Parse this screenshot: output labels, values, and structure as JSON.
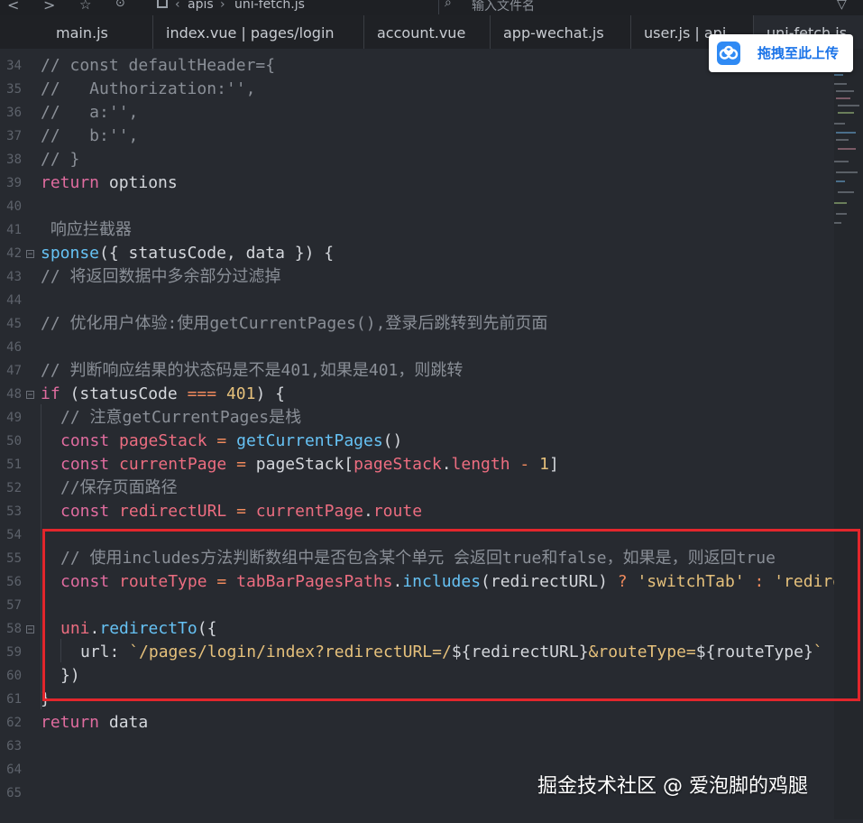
{
  "topbar": {
    "nav_back": "<",
    "nav_forward": ">",
    "breadcrumb": [
      "apis",
      "uni-fetch.js"
    ],
    "search_placeholder": "输入文件名"
  },
  "tabs": [
    {
      "label": "main.js"
    },
    {
      "label": "index.vue | pages/login"
    },
    {
      "label": "account.vue"
    },
    {
      "label": "app-wechat.js"
    },
    {
      "label": "user.js | api"
    },
    {
      "label": "uni-fetch.js"
    }
  ],
  "upload_button": {
    "label": "拖拽至此上传",
    "icon": "cloud-icon"
  },
  "code_lines": [
    {
      "n": "34",
      "fold": "",
      "indent": 0,
      "tokens": [
        [
          "c-cm",
          "// const defaultHeader={"
        ]
      ]
    },
    {
      "n": "35",
      "fold": "",
      "indent": 0,
      "tokens": [
        [
          "c-cm",
          "//   Authorization:'',"
        ]
      ]
    },
    {
      "n": "36",
      "fold": "",
      "indent": 0,
      "tokens": [
        [
          "c-cm",
          "//   a:'',"
        ]
      ]
    },
    {
      "n": "37",
      "fold": "",
      "indent": 0,
      "tokens": [
        [
          "c-cm",
          "//   b:'',"
        ]
      ]
    },
    {
      "n": "38",
      "fold": "",
      "indent": 0,
      "tokens": [
        [
          "c-cm",
          "// }"
        ]
      ]
    },
    {
      "n": "39",
      "fold": "",
      "indent": 0,
      "tokens": [
        [
          "c-kw",
          "return"
        ],
        [
          "c-pl",
          " options"
        ]
      ]
    },
    {
      "n": "40",
      "fold": "",
      "indent": 0,
      "tokens": []
    },
    {
      "n": "41",
      "fold": "",
      "indent": 0,
      "tokens": [
        [
          "c-cm",
          " 响应拦截器"
        ]
      ]
    },
    {
      "n": "42",
      "fold": "⊟",
      "indent": 0,
      "tokens": [
        [
          "c-fn",
          "sponse"
        ],
        [
          "c-pl",
          "({ statusCode, data }) {"
        ]
      ]
    },
    {
      "n": "43",
      "fold": "",
      "indent": 0,
      "tokens": [
        [
          "c-cm",
          "// 将返回数据中多余部分过滤掉"
        ]
      ]
    },
    {
      "n": "44",
      "fold": "",
      "indent": 0,
      "tokens": []
    },
    {
      "n": "45",
      "fold": "",
      "indent": 0,
      "tokens": [
        [
          "c-cm",
          "// 优化用户体验:使用getCurrentPages(),登录后跳转到先前页面"
        ]
      ]
    },
    {
      "n": "46",
      "fold": "",
      "indent": 0,
      "tokens": []
    },
    {
      "n": "47",
      "fold": "",
      "indent": 0,
      "tokens": [
        [
          "c-cm",
          "// 判断响应结果的状态码是不是401,如果是401，则跳转"
        ]
      ]
    },
    {
      "n": "48",
      "fold": "⊟",
      "indent": 0,
      "tokens": [
        [
          "c-kw",
          "if"
        ],
        [
          "c-pl",
          " (statusCode "
        ],
        [
          "c-op",
          "==="
        ],
        [
          "c-pl",
          " "
        ],
        [
          "c-num",
          "401"
        ],
        [
          "c-pl",
          ") {"
        ]
      ]
    },
    {
      "n": "49",
      "fold": "",
      "indent": 1,
      "tokens": [
        [
          "c-cm",
          "// 注意getCurrentPages是栈"
        ]
      ]
    },
    {
      "n": "50",
      "fold": "",
      "indent": 1,
      "tokens": [
        [
          "c-kw",
          "const"
        ],
        [
          "c-pl",
          " "
        ],
        [
          "c-var",
          "pageStack"
        ],
        [
          "c-pl",
          " "
        ],
        [
          "c-op",
          "="
        ],
        [
          "c-pl",
          " "
        ],
        [
          "c-fn",
          "getCurrentPages"
        ],
        [
          "c-pl",
          "()"
        ]
      ]
    },
    {
      "n": "51",
      "fold": "",
      "indent": 1,
      "tokens": [
        [
          "c-kw",
          "const"
        ],
        [
          "c-pl",
          " "
        ],
        [
          "c-var",
          "currentPage"
        ],
        [
          "c-pl",
          " "
        ],
        [
          "c-op",
          "="
        ],
        [
          "c-pl",
          " pageStack["
        ],
        [
          "c-var",
          "pageStack"
        ],
        [
          "c-pl",
          "."
        ],
        [
          "c-var",
          "length"
        ],
        [
          "c-pl",
          " "
        ],
        [
          "c-op",
          "-"
        ],
        [
          "c-pl",
          " "
        ],
        [
          "c-num",
          "1"
        ],
        [
          "c-pl",
          "]"
        ]
      ]
    },
    {
      "n": "52",
      "fold": "",
      "indent": 1,
      "tokens": [
        [
          "c-cm",
          "//保存页面路径"
        ]
      ]
    },
    {
      "n": "53",
      "fold": "",
      "indent": 1,
      "tokens": [
        [
          "c-kw",
          "const"
        ],
        [
          "c-pl",
          " "
        ],
        [
          "c-var",
          "redirectURL"
        ],
        [
          "c-pl",
          " "
        ],
        [
          "c-op",
          "="
        ],
        [
          "c-pl",
          " "
        ],
        [
          "c-var",
          "currentPage"
        ],
        [
          "c-pl",
          "."
        ],
        [
          "c-var",
          "route"
        ]
      ]
    },
    {
      "n": "54",
      "fold": "",
      "indent": 0,
      "tokens": []
    },
    {
      "n": "55",
      "fold": "",
      "indent": 1,
      "tokens": [
        [
          "c-cm",
          "// 使用includes方法判断数组中是否包含某个单元 会返回true和false，如果是，则返回true"
        ]
      ]
    },
    {
      "n": "56",
      "fold": "",
      "indent": 1,
      "tokens": [
        [
          "c-kw",
          "const"
        ],
        [
          "c-pl",
          " "
        ],
        [
          "c-var",
          "routeType"
        ],
        [
          "c-pl",
          " "
        ],
        [
          "c-op",
          "="
        ],
        [
          "c-pl",
          " "
        ],
        [
          "c-var",
          "tabBarPagesPaths"
        ],
        [
          "c-pl",
          "."
        ],
        [
          "c-fn",
          "includes"
        ],
        [
          "c-pl",
          "(redirectURL) "
        ],
        [
          "c-op",
          "?"
        ],
        [
          "c-pl",
          " "
        ],
        [
          "c-str",
          "'switchTab'"
        ],
        [
          "c-pl",
          " "
        ],
        [
          "c-op",
          ":"
        ],
        [
          "c-pl",
          " "
        ],
        [
          "c-str",
          "'redirectTo'"
        ]
      ]
    },
    {
      "n": "57",
      "fold": "",
      "indent": 0,
      "tokens": []
    },
    {
      "n": "58",
      "fold": "⊟",
      "indent": 1,
      "tokens": [
        [
          "c-var",
          "uni"
        ],
        [
          "c-pl",
          "."
        ],
        [
          "c-fn",
          "redirectTo"
        ],
        [
          "c-pl",
          "({"
        ]
      ]
    },
    {
      "n": "59",
      "fold": "",
      "indent": 2,
      "tokens": [
        [
          "c-pl",
          "url: "
        ],
        [
          "c-str",
          "`/pages/login/index?redirectURL=/"
        ],
        [
          "c-pl",
          "${redirectURL}"
        ],
        [
          "c-str",
          "&routeType="
        ],
        [
          "c-pl",
          "${routeType}"
        ],
        [
          "c-str",
          "`"
        ]
      ]
    },
    {
      "n": "60",
      "fold": "",
      "indent": 1,
      "tokens": [
        [
          "c-pl",
          "})"
        ]
      ]
    },
    {
      "n": "61",
      "fold": "",
      "indent": 0,
      "tokens": [
        [
          "c-pl",
          "}"
        ]
      ]
    },
    {
      "n": "62",
      "fold": "",
      "indent": 0,
      "tokens": [
        [
          "c-kw",
          "return"
        ],
        [
          "c-pl",
          " data"
        ]
      ]
    },
    {
      "n": "63",
      "fold": "",
      "indent": 0,
      "tokens": []
    },
    {
      "n": "64",
      "fold": "",
      "indent": 0,
      "tokens": []
    },
    {
      "n": "65",
      "fold": "",
      "indent": 0,
      "tokens": []
    }
  ],
  "watermark": "掘金技术社区 @ 爱泡脚的鸡腿"
}
